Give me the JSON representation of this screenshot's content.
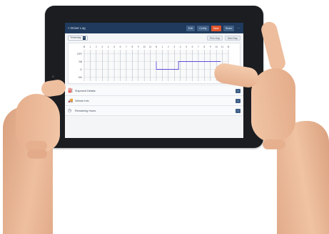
{
  "app": {
    "title": "< Driver Log",
    "buttons": [
      "Edit",
      "Certify",
      "Save",
      "Share",
      "⋯"
    ],
    "accent": "#e0532b",
    "nav_color": "#1f3a5c"
  },
  "toolbar": {
    "date_select": "Yesterday",
    "left_btn": "Prev Day",
    "right_btn": "Next Day"
  },
  "chart_data": {
    "type": "line",
    "rows": [
      "OFF",
      "SB",
      "D",
      "ON"
    ],
    "x_ticks": [
      "M",
      "1",
      "2",
      "3",
      "4",
      "5",
      "6",
      "7",
      "8",
      "9",
      "10",
      "11",
      "N",
      "1",
      "2",
      "3",
      "4",
      "5",
      "6",
      "7",
      "8",
      "9",
      "10",
      "11",
      "M"
    ],
    "totals": [
      "",
      "",
      "",
      ""
    ],
    "series": [
      {
        "color": "#5a4ed9",
        "segments": [
          {
            "hour": 12.0,
            "row": 1
          },
          {
            "hour": 12.0,
            "row": 2
          },
          {
            "hour": 15.7,
            "row": 2
          },
          {
            "hour": 15.7,
            "row": 1
          },
          {
            "hour": 22.7,
            "row": 1
          }
        ]
      }
    ]
  },
  "rows": [
    {
      "icon": "fuel-icon",
      "glyph": "⛽",
      "label": "Shipment Details"
    },
    {
      "icon": "truck-icon",
      "glyph": "🚚",
      "label": "Vehicle Info"
    },
    {
      "icon": "clock-icon",
      "glyph": "◷",
      "label": "Remaining Hours"
    }
  ]
}
